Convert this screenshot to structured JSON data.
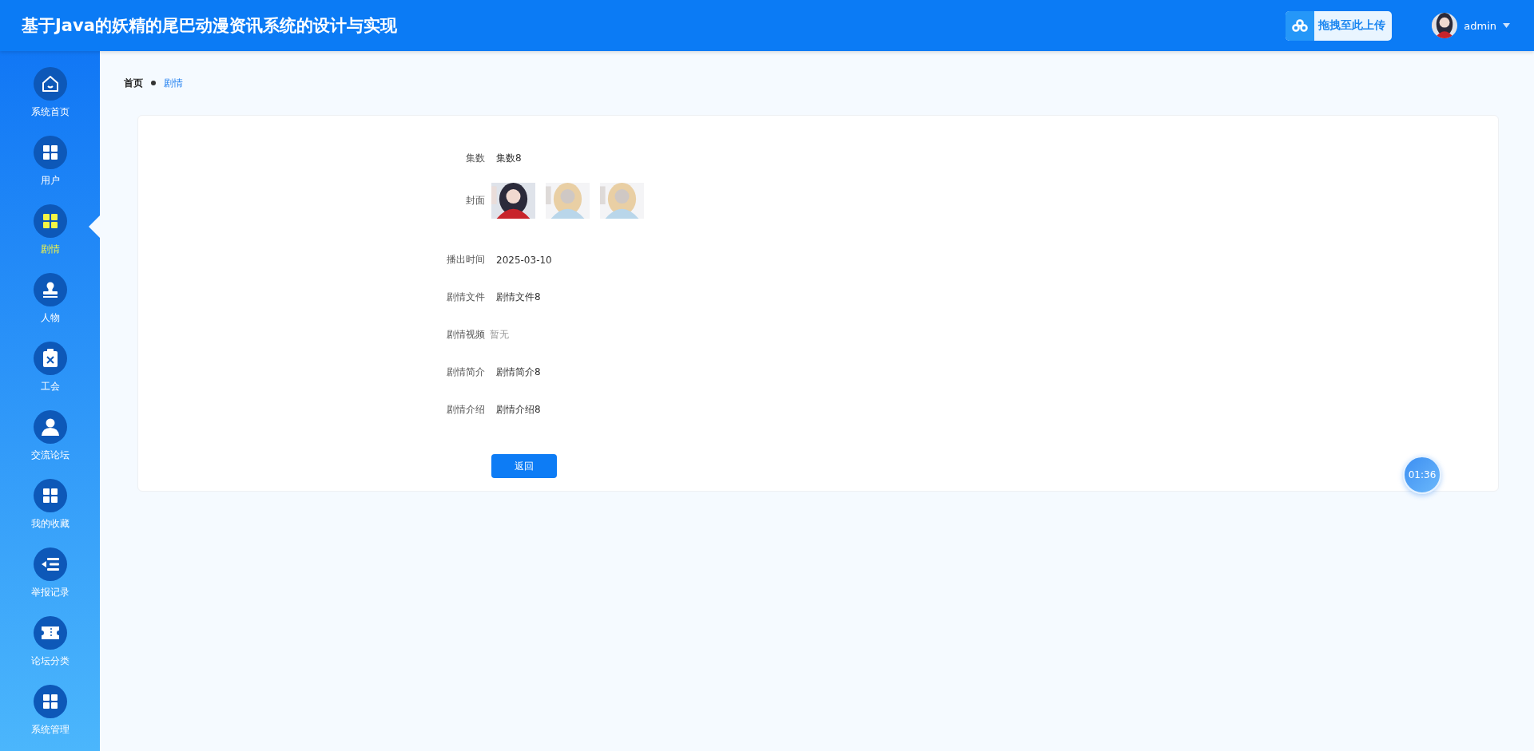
{
  "header": {
    "title": "基于Java的妖精的尾巴动漫资讯系统的设计与实现",
    "upload_button": "拖拽至此上传",
    "user": {
      "name": "admin"
    }
  },
  "sidebar": {
    "items": [
      {
        "label": "系统首页",
        "kind": "home",
        "selected": false
      },
      {
        "label": "用户",
        "kind": "grid",
        "selected": false
      },
      {
        "label": "剧情",
        "kind": "grid",
        "selected": true
      },
      {
        "label": "人物",
        "kind": "stamp",
        "selected": false
      },
      {
        "label": "工会",
        "kind": "clipboard",
        "selected": false
      },
      {
        "label": "交流论坛",
        "kind": "user",
        "selected": false
      },
      {
        "label": "我的收藏",
        "kind": "grid",
        "selected": false
      },
      {
        "label": "举报记录",
        "kind": "list",
        "selected": false
      },
      {
        "label": "论坛分类",
        "kind": "ticket",
        "selected": false
      },
      {
        "label": "系统管理",
        "kind": "grid",
        "selected": false
      }
    ]
  },
  "breadcrumb": [
    {
      "label": "首页",
      "selected": false
    },
    {
      "label": "剧情",
      "selected": true
    }
  ],
  "detail": {
    "fields": [
      {
        "label": "集数",
        "kind": "text",
        "value": "集数8"
      },
      {
        "label": "封面",
        "kind": "images"
      },
      {
        "label": "播出时间",
        "kind": "text",
        "value": "2025-03-10"
      },
      {
        "label": "剧情文件",
        "kind": "text",
        "value": "剧情文件8"
      },
      {
        "label": "剧情视频",
        "kind": "empty",
        "value": "暂无"
      },
      {
        "label": "剧情简介",
        "kind": "text",
        "value": "剧情简介8"
      },
      {
        "label": "剧情介绍",
        "kind": "text",
        "value": "剧情介绍8"
      }
    ],
    "back_button": "返回"
  },
  "timer": "01:36"
}
